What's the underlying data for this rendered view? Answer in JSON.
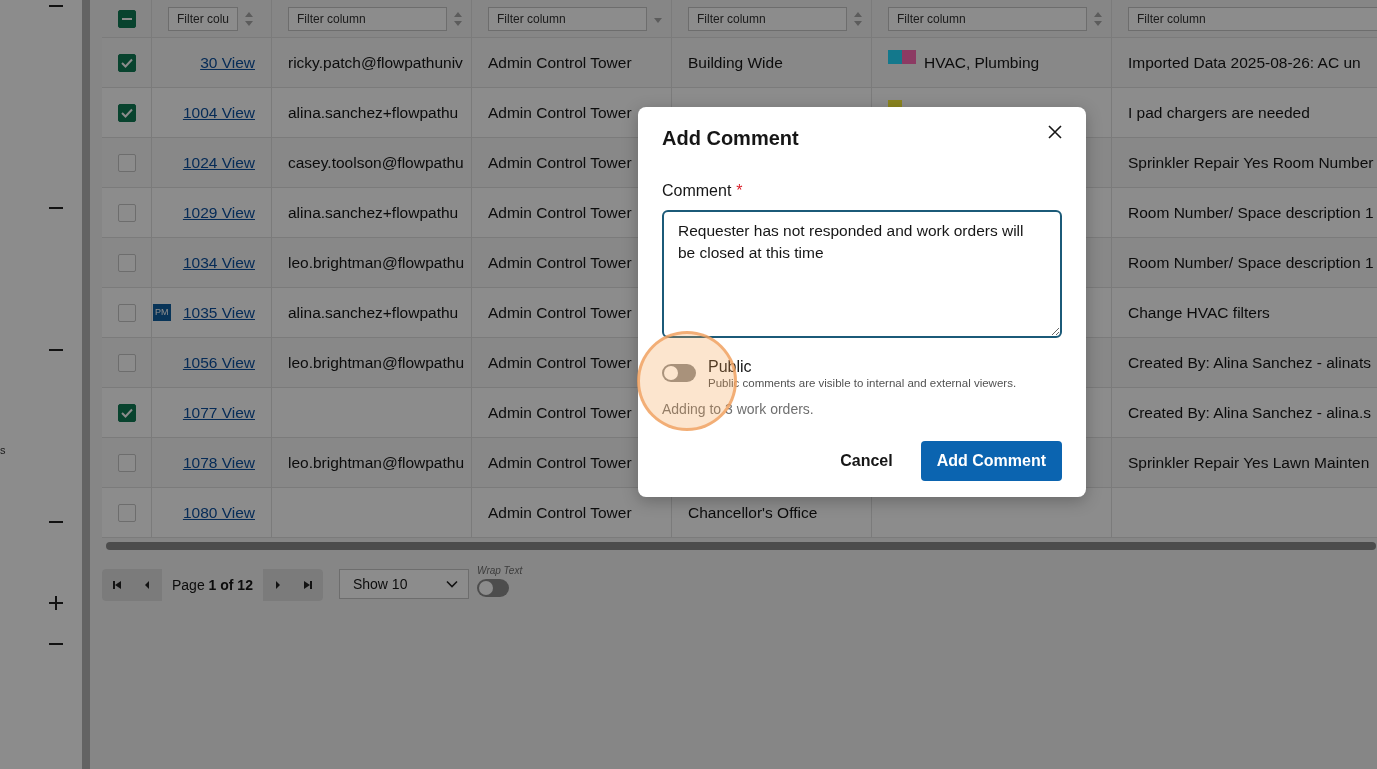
{
  "sidebar": {
    "items": [
      {
        "kind": "collapse"
      },
      {
        "kind": "collapse"
      },
      {
        "kind": "collapse"
      },
      {
        "kind": "text",
        "label": "s"
      },
      {
        "kind": "collapse"
      },
      {
        "kind": "expand"
      },
      {
        "kind": "collapse"
      }
    ]
  },
  "table": {
    "select_all": {
      "indeterminate": true
    },
    "filters": [
      {
        "placeholder": "Filter colu",
        "sorted": false
      },
      {
        "placeholder": "Filter column",
        "sorted": false
      },
      {
        "placeholder": "Filter column",
        "sorted": true
      },
      {
        "placeholder": "Filter column",
        "sorted": false
      },
      {
        "placeholder": "Filter column",
        "sorted": false
      },
      {
        "placeholder": "Filter column"
      }
    ],
    "rows": [
      {
        "checked": true,
        "pm": null,
        "id": "30 View",
        "email": "ricky.patch@flowpathuniv",
        "location": "Admin Control Tower",
        "building": "Building Wide",
        "swatches": [
          {
            "color": "#14788f"
          },
          {
            "color": "#8c3a63"
          }
        ],
        "category": "HVAC, Plumbing",
        "description": "Imported Data 2025-08-26: AC un"
      },
      {
        "checked": true,
        "pm": null,
        "id": "1004 View",
        "email": "alina.sanchez+flowpathu",
        "location": "Admin Control Tower",
        "swatches": [
          {
            "color": "#8a8420"
          }
        ],
        "description": "I pad chargers are needed"
      },
      {
        "checked": false,
        "pm": null,
        "id": "1024 View",
        "email": "casey.toolson@flowpathu",
        "location": "Admin Control Tower",
        "description": "Sprinkler Repair Yes Room Number"
      },
      {
        "checked": false,
        "pm": null,
        "id": "1029 View",
        "email": "alina.sanchez+flowpathu",
        "location": "Admin Control Tower",
        "description": "Room Number/ Space description 1"
      },
      {
        "checked": false,
        "pm": null,
        "id": "1034 View",
        "email": "leo.brightman@flowpathu",
        "location": "Admin Control Tower",
        "description": "Room Number/ Space description 1"
      },
      {
        "checked": false,
        "pm": "PM",
        "id": "1035 View",
        "email": "alina.sanchez+flowpathu",
        "location": "Admin Control Tower",
        "description": "Change HVAC filters"
      },
      {
        "checked": false,
        "pm": null,
        "id": "1056 View",
        "email": "leo.brightman@flowpathu",
        "location": "Admin Control Tower",
        "description": "Created By: Alina Sanchez - alinats"
      },
      {
        "checked": true,
        "pm": null,
        "id": "1077 View",
        "location": "Admin Control Tower",
        "description": "Created By: Alina Sanchez - alina.s"
      },
      {
        "checked": false,
        "pm": null,
        "id": "1078 View",
        "email": "leo.brightman@flowpathu",
        "location": "Admin Control Tower",
        "description": "Sprinkler Repair Yes Lawn Mainten"
      },
      {
        "checked": false,
        "pm": null,
        "id": "1080 View",
        "location": "Admin Control Tower",
        "building": "Chancellor's Office"
      }
    ]
  },
  "pagination": {
    "page_text": "Page **1 of 12**",
    "page_size": "Show 10",
    "wrap_label": "Wrap Text",
    "wrap_on": false
  },
  "dialog": {
    "title": "Add Comment",
    "field_label": "Comment",
    "required_mark": "*",
    "value": "Requester has not responded and work orders will be closed at this time ",
    "public_label": "Public",
    "public_on": false,
    "public_help": "Public comments are visible to internal and external viewers.",
    "summary": "Adding to 3 work orders.",
    "buttons": [
      {
        "label": "Cancel",
        "kind": "secondary"
      },
      {
        "label": "Add Comment",
        "kind": "primary"
      }
    ]
  },
  "highlight": {
    "shown": true
  }
}
